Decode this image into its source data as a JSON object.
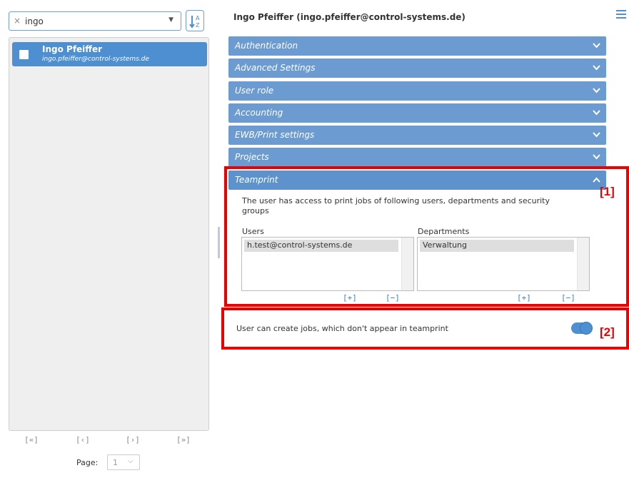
{
  "search": {
    "value": "ingo",
    "clear_glyph": "×",
    "caret_glyph": "▼"
  },
  "sort_button": {
    "icon": "sort-az-icon"
  },
  "user_list": {
    "items": [
      {
        "name": "Ingo Pfeiffer",
        "email": "ingo.pfeiffer@control-systems.de"
      }
    ]
  },
  "pager": {
    "first": "[«]",
    "prev": "[‹]",
    "next": "[›]",
    "last": "[»]",
    "page_label": "Page:",
    "page_value": "1"
  },
  "detail": {
    "title": "Ingo Pfeiffer (ingo.pfeiffer@control-systems.de)",
    "menu_icon": "hamburger-menu-icon",
    "sections": [
      {
        "label": "Authentication",
        "expanded": false
      },
      {
        "label": "Advanced Settings",
        "expanded": false
      },
      {
        "label": "User role",
        "expanded": false
      },
      {
        "label": "Accounting",
        "expanded": false
      },
      {
        "label": "EWB/Print settings",
        "expanded": false
      },
      {
        "label": "Projects",
        "expanded": false
      },
      {
        "label": "Teamprint",
        "expanded": true
      }
    ],
    "teamprint": {
      "description": "The user has access to print jobs of following users, departments and security groups",
      "users_label": "Users",
      "users": [
        "h.test@control-systems.de"
      ],
      "departments_label": "Departments",
      "departments": [
        "Verwaltung"
      ],
      "add_label": "[+]",
      "remove_label": "[−]"
    },
    "option": {
      "label": "User can create jobs, which don't appear in teamprint",
      "enabled": true
    }
  },
  "callouts": [
    {
      "label": "[1]"
    },
    {
      "label": "[2]"
    }
  ],
  "colors": {
    "accent": "#4d8fd1",
    "accordion": "#6b9bd0",
    "callout": "#ec0000"
  }
}
